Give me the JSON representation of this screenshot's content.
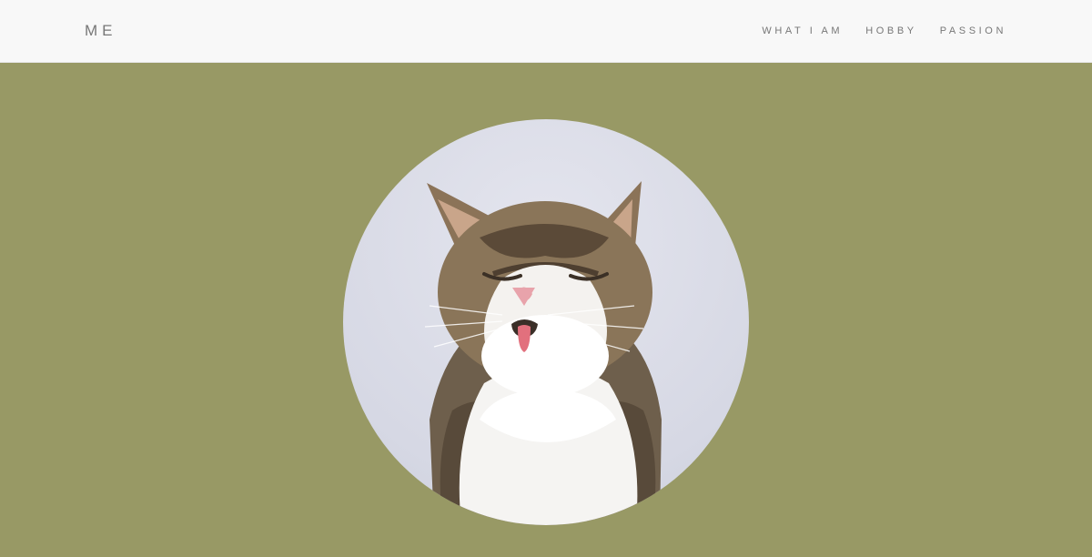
{
  "navbar": {
    "brand": "ME",
    "links": [
      {
        "label": "WHAT I AM"
      },
      {
        "label": "HOBBY"
      },
      {
        "label": "PASSION"
      }
    ]
  },
  "hero": {
    "background_color": "#989965",
    "avatar": {
      "subject": "cat-photo"
    }
  }
}
